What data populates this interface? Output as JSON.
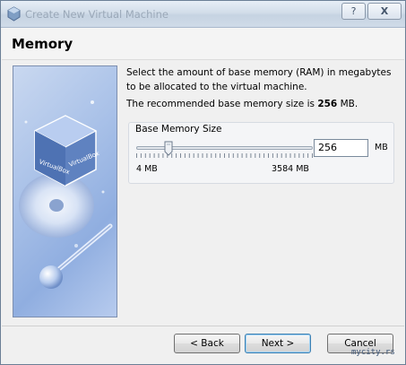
{
  "window": {
    "title": "Create New Virtual Machine",
    "help_label": "?",
    "close_label": "X"
  },
  "header": {
    "title": "Memory"
  },
  "main": {
    "description": "Select the amount of base memory (RAM) in megabytes to be allocated to the virtual machine.",
    "recommendation_prefix": "The recommended base memory size is ",
    "recommendation_value": "256",
    "recommendation_suffix": " MB.",
    "group_label": "Base Memory Size",
    "slider_min_label": "4 MB",
    "slider_max_label": "3584 MB",
    "slider_value_mb": 256,
    "memory_value": "256",
    "unit_label": "MB"
  },
  "buttons": {
    "back": "< Back",
    "next": "Next >",
    "cancel": "Cancel"
  },
  "watermark": "mycity.rs",
  "colors": {
    "accent": "#3c7fb1",
    "side_panel": "#a9c1e8"
  },
  "icons": {
    "app": "virtualbox-icon",
    "side": "virtualbox-logo-graphic"
  }
}
